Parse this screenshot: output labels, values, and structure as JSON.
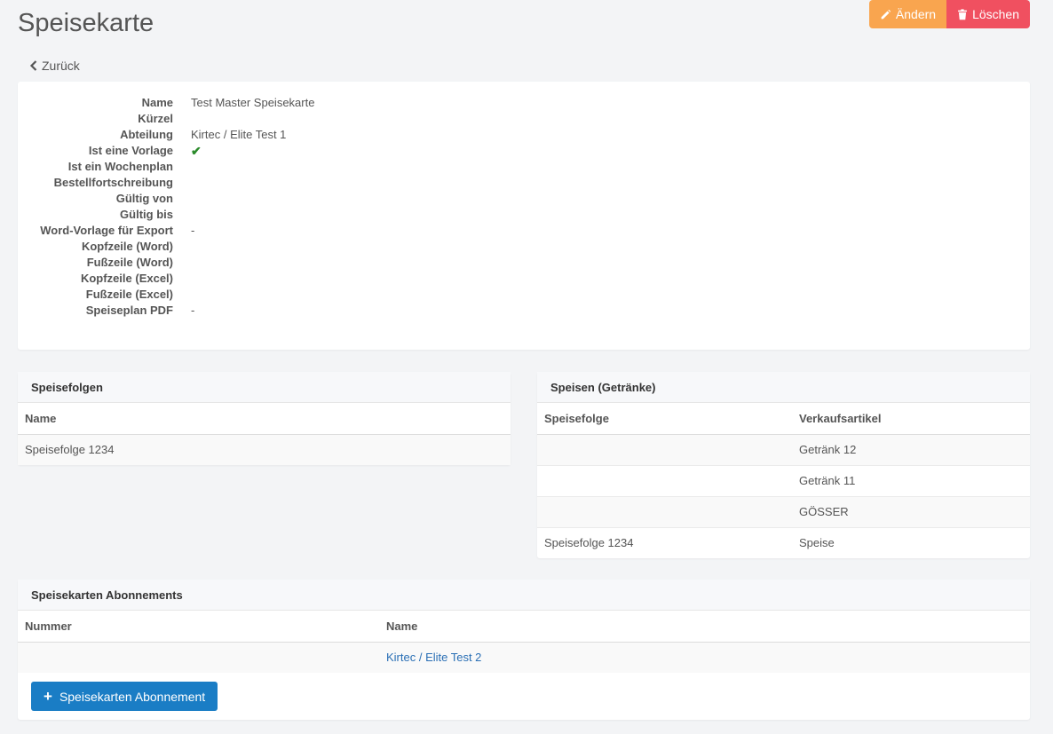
{
  "page": {
    "title": "Speisekarte",
    "back_label": "Zurück"
  },
  "actions": {
    "edit_label": "Ändern",
    "delete_label": "Löschen"
  },
  "details": [
    {
      "label": "Name",
      "value": "Test Master Speisekarte"
    },
    {
      "label": "Kürzel",
      "value": ""
    },
    {
      "label": "Abteilung",
      "value": "Kirtec / Elite Test 1"
    },
    {
      "label": "Ist eine Vorlage",
      "value": "",
      "checked": true
    },
    {
      "label": "Ist ein Wochenplan",
      "value": ""
    },
    {
      "label": "Bestellfortschreibung",
      "value": ""
    },
    {
      "label": "Gültig von",
      "value": ""
    },
    {
      "label": "Gültig bis",
      "value": ""
    },
    {
      "label": "Word-Vorlage für Export",
      "value": "-"
    },
    {
      "label": "Kopfzeile (Word)",
      "value": ""
    },
    {
      "label": "Fußzeile (Word)",
      "value": ""
    },
    {
      "label": "Kopfzeile (Excel)",
      "value": ""
    },
    {
      "label": "Fußzeile (Excel)",
      "value": ""
    },
    {
      "label": "Speiseplan PDF",
      "value": "-"
    }
  ],
  "speisefolgen": {
    "title": "Speisefolgen",
    "columns": [
      "Name"
    ],
    "rows": [
      [
        "Speisefolge 1234"
      ]
    ]
  },
  "speisen": {
    "title": "Speisen (Getränke)",
    "columns": [
      "Speisefolge",
      "Verkaufsartikel"
    ],
    "rows": [
      [
        "",
        "Getränk 12"
      ],
      [
        "",
        "Getränk 11"
      ],
      [
        "",
        "GÖSSER"
      ],
      [
        "Speisefolge 1234",
        "Speise"
      ]
    ]
  },
  "abonnements": {
    "title": "Speisekarten Abonnements",
    "columns": [
      "Nummer",
      "Name"
    ],
    "rows": [
      [
        "",
        "Kirtec / Elite Test 2"
      ]
    ],
    "add_label": "Speisekarten Abonnement"
  }
}
